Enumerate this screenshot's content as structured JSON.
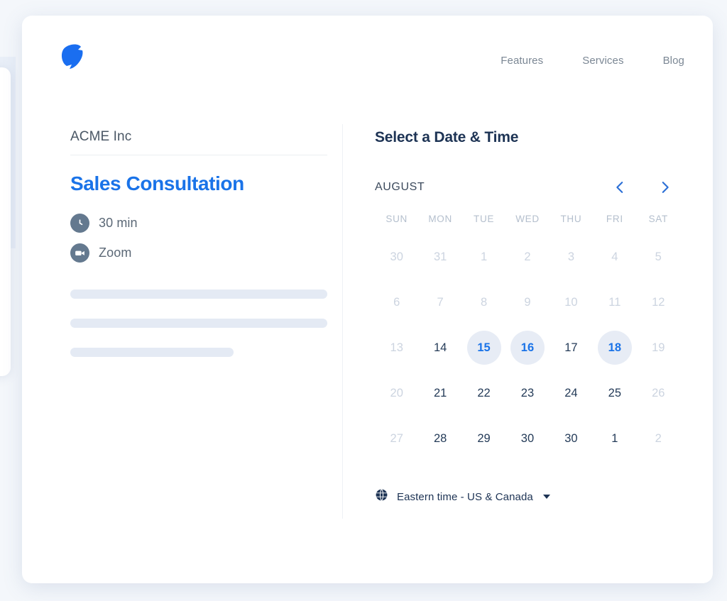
{
  "header": {
    "logo_icon": "leaf-logo-icon",
    "nav": [
      {
        "label": "Features"
      },
      {
        "label": "Services"
      },
      {
        "label": "Blog"
      }
    ]
  },
  "event": {
    "org_name": "ACME Inc",
    "title": "Sales Consultation",
    "duration_icon": "clock-icon",
    "duration": "30 min",
    "location_icon": "video-camera-icon",
    "location": "Zoom",
    "description_placeholders": 3
  },
  "scheduler": {
    "panel_title": "Select a Date & Time",
    "month_label": "AUGUST",
    "prev_icon": "chevron-left-icon",
    "next_icon": "chevron-right-icon",
    "weekdays": [
      "SUN",
      "MON",
      "TUE",
      "WED",
      "THU",
      "FRI",
      "SAT"
    ],
    "days": [
      {
        "label": "30",
        "state": "muted"
      },
      {
        "label": "31",
        "state": "muted"
      },
      {
        "label": "1",
        "state": "muted"
      },
      {
        "label": "2",
        "state": "muted"
      },
      {
        "label": "3",
        "state": "muted"
      },
      {
        "label": "4",
        "state": "muted"
      },
      {
        "label": "5",
        "state": "muted"
      },
      {
        "label": "6",
        "state": "muted"
      },
      {
        "label": "7",
        "state": "muted"
      },
      {
        "label": "8",
        "state": "muted"
      },
      {
        "label": "9",
        "state": "muted"
      },
      {
        "label": "10",
        "state": "muted"
      },
      {
        "label": "11",
        "state": "muted"
      },
      {
        "label": "12",
        "state": "muted"
      },
      {
        "label": "13",
        "state": "muted"
      },
      {
        "label": "14",
        "state": "normal"
      },
      {
        "label": "15",
        "state": "active"
      },
      {
        "label": "16",
        "state": "active"
      },
      {
        "label": "17",
        "state": "normal"
      },
      {
        "label": "18",
        "state": "active"
      },
      {
        "label": "19",
        "state": "muted"
      },
      {
        "label": "20",
        "state": "muted"
      },
      {
        "label": "21",
        "state": "normal"
      },
      {
        "label": "22",
        "state": "normal"
      },
      {
        "label": "23",
        "state": "normal"
      },
      {
        "label": "24",
        "state": "normal"
      },
      {
        "label": "25",
        "state": "normal"
      },
      {
        "label": "26",
        "state": "muted"
      },
      {
        "label": "27",
        "state": "muted"
      },
      {
        "label": "28",
        "state": "normal"
      },
      {
        "label": "29",
        "state": "normal"
      },
      {
        "label": "30",
        "state": "normal"
      },
      {
        "label": "30",
        "state": "normal"
      },
      {
        "label": "1",
        "state": "normal"
      },
      {
        "label": "2",
        "state": "muted"
      }
    ],
    "timezone_icon": "globe-icon",
    "timezone": "Eastern time - US & Canada"
  },
  "colors": {
    "accent": "#1a73e8",
    "heading": "#1d3354",
    "muted": "#ccd4e0",
    "active_bg": "#e7ecf5",
    "page_bg": "#f4f7fb"
  }
}
